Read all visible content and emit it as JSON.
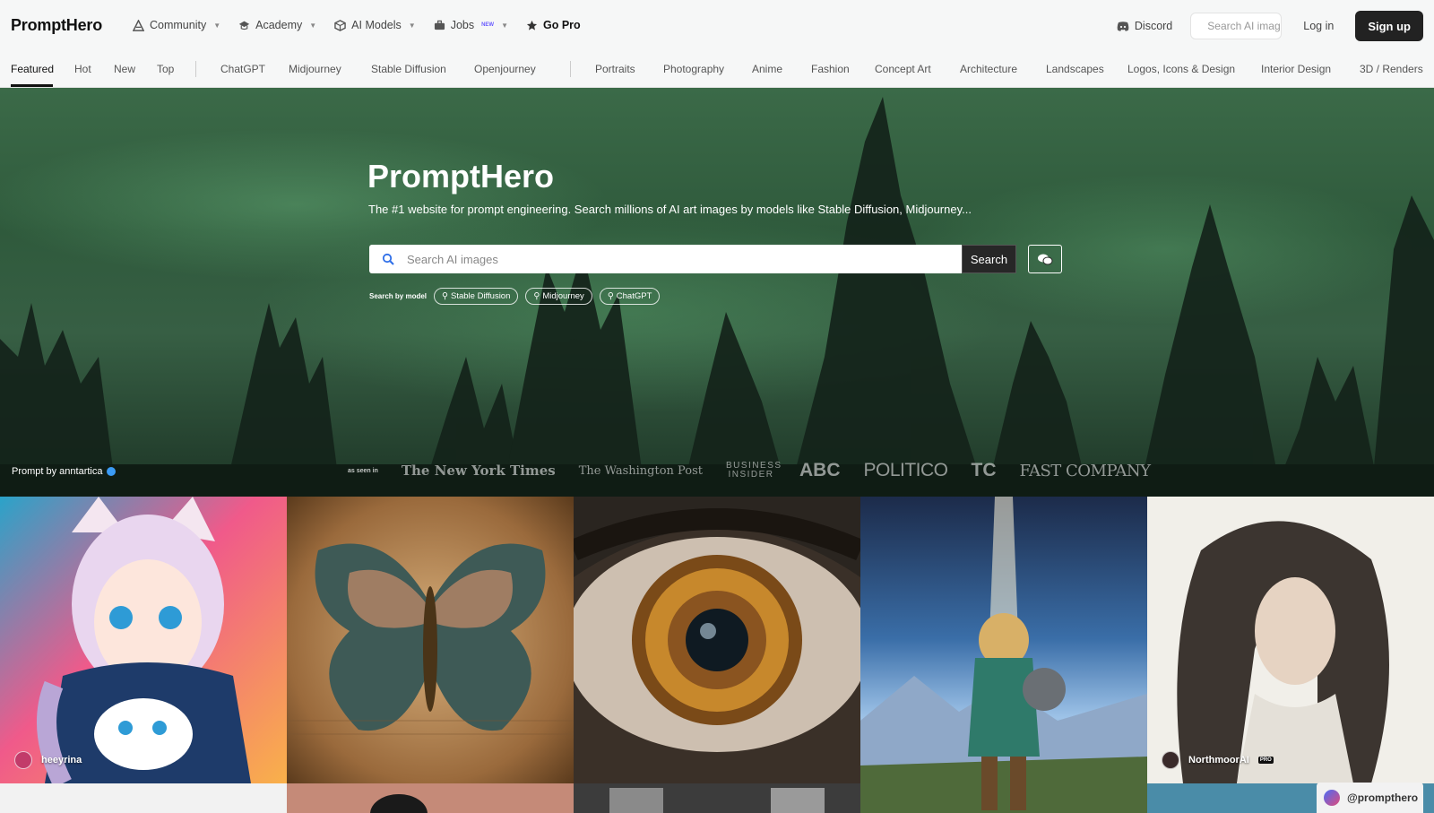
{
  "topbar": {
    "logo": "PromptHero",
    "nav": [
      {
        "label": "Community",
        "icon": "community-icon"
      },
      {
        "label": "Academy",
        "icon": "academy-icon"
      },
      {
        "label": "AI Models",
        "icon": "cube-icon"
      },
      {
        "label": "Jobs",
        "icon": "briefcase-icon",
        "badge": "NEW"
      },
      {
        "label": "Go Pro",
        "icon": "star-icon"
      }
    ],
    "discord_label": "Discord",
    "search_placeholder": "Search AI images",
    "login_label": "Log in",
    "signup_label": "Sign up"
  },
  "categories": {
    "sort": [
      "Featured",
      "Hot",
      "New",
      "Top"
    ],
    "models": [
      "ChatGPT",
      "Midjourney",
      "Stable Diffusion",
      "Openjourney"
    ],
    "topics": [
      "Portraits",
      "Photography",
      "Anime",
      "Fashion",
      "Concept Art",
      "Architecture",
      "Landscapes",
      "Logos, Icons & Design",
      "Interior Design",
      "3D / Renders"
    ],
    "active": "Featured"
  },
  "hero": {
    "title": "PromptHero",
    "subtitle": "The #1 website for prompt engineering. Search millions of AI art images by models like Stable Diffusion, Midjourney...",
    "search_placeholder": "Search AI images",
    "search_button": "Search",
    "search_by_label": "Search by model",
    "chips": [
      "Stable Diffusion",
      "Midjourney",
      "ChatGPT"
    ],
    "prompt_by": "Prompt by anntartica",
    "as_seen_in": "as seen in",
    "press": [
      "The New York Times",
      "The Washington Post",
      "BUSINESS INSIDER",
      "ABC",
      "POLITICO",
      "TC",
      "FAST COMPANY"
    ]
  },
  "gallery": {
    "tiles": [
      {
        "subject": "anime-girl-with-cat",
        "user": "heeyrina",
        "pro": false
      },
      {
        "subject": "butterfly-sketch",
        "user": "",
        "pro": false
      },
      {
        "subject": "mechanical-eye",
        "user": "",
        "pro": false
      },
      {
        "subject": "warrior-landscape",
        "user": "",
        "pro": false
      },
      {
        "subject": "pencil-portrait",
        "user": "NorthmoorAI",
        "pro": true
      }
    ],
    "pro_badge": "PRO"
  },
  "handle": "@prompthero",
  "colors": {
    "accent": "#222222",
    "verified": "#3b9bf5"
  }
}
